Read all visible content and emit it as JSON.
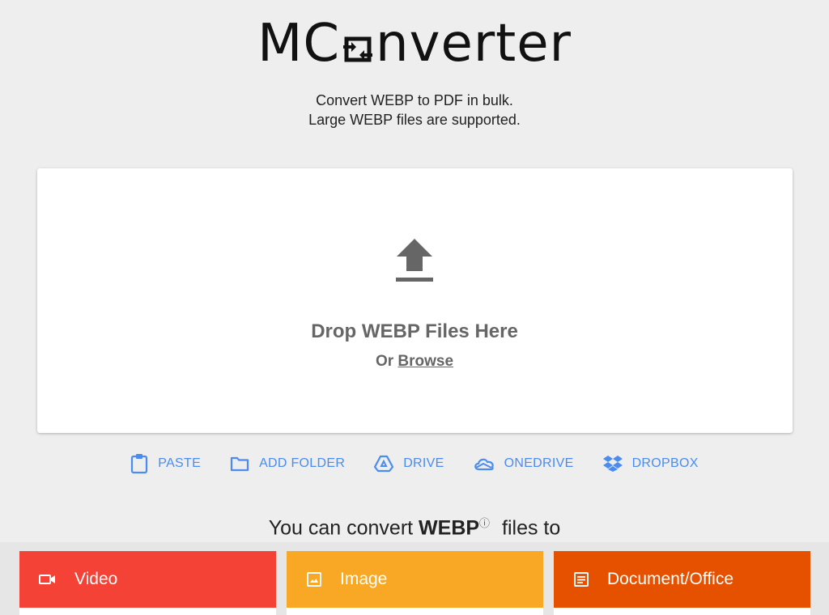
{
  "logo": {
    "prefix": "MC",
    "suffix": "nverter"
  },
  "tagline": {
    "line1": "Convert WEBP to PDF in bulk.",
    "line2": "Large WEBP files are supported."
  },
  "dropzone": {
    "title": "Drop WEBP Files Here",
    "or_label": "Or",
    "browse_label": "Browse"
  },
  "sources": [
    {
      "label": "PASTE",
      "icon": "clipboard-icon"
    },
    {
      "label": "ADD FOLDER",
      "icon": "folder-icon"
    },
    {
      "label": "DRIVE",
      "icon": "google-drive-icon"
    },
    {
      "label": "ONEDRIVE",
      "icon": "onedrive-icon"
    },
    {
      "label": "DROPBOX",
      "icon": "dropbox-icon"
    }
  ],
  "convert": {
    "prefix": "You can convert",
    "format": "WEBP",
    "info": "ⓘ",
    "suffix": "files to"
  },
  "categories": [
    {
      "label": "Video",
      "icon": "video-camera-icon",
      "color": "#f44336"
    },
    {
      "label": "Image",
      "icon": "image-icon",
      "color": "#f9a825"
    },
    {
      "label": "Document/Office",
      "icon": "document-icon",
      "color": "#e65100"
    }
  ],
  "colors": {
    "accent_link": "#4a8cf0",
    "background": "#eeeeee"
  }
}
